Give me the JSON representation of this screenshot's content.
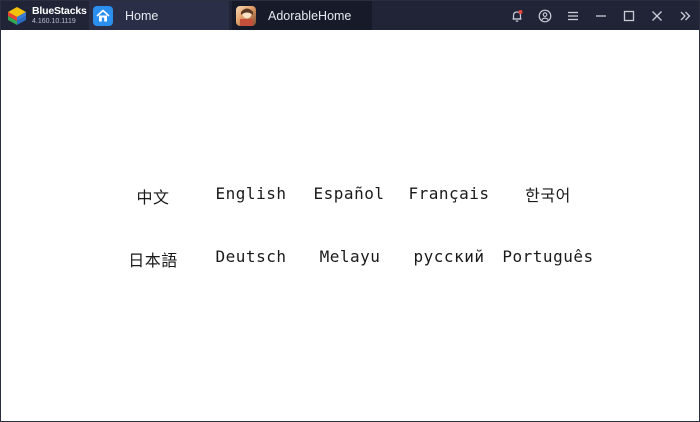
{
  "app": {
    "brand_name": "BlueStacks",
    "version": "4.160.10.1119"
  },
  "tabs": [
    {
      "label": "Home",
      "icon": "home-icon"
    },
    {
      "label": "AdorableHome",
      "icon": "app-thumbnail-icon"
    }
  ],
  "controls": [
    "bell-icon",
    "account-icon",
    "menu-icon",
    "minimize-icon",
    "maximize-icon",
    "close-icon",
    "sidebar-toggle-icon"
  ],
  "colors": {
    "titlebar": "#202436",
    "home_tab": "#2a2f47",
    "active_tab": "#161a29",
    "home_icon_bg": "#2b8ff0",
    "notification_dot": "#e8473f"
  },
  "languages": [
    [
      "中文",
      "English",
      "Español",
      "Français",
      "한국어"
    ],
    [
      "日本語",
      "Deutsch",
      "Melayu",
      "русский",
      "Português"
    ]
  ]
}
